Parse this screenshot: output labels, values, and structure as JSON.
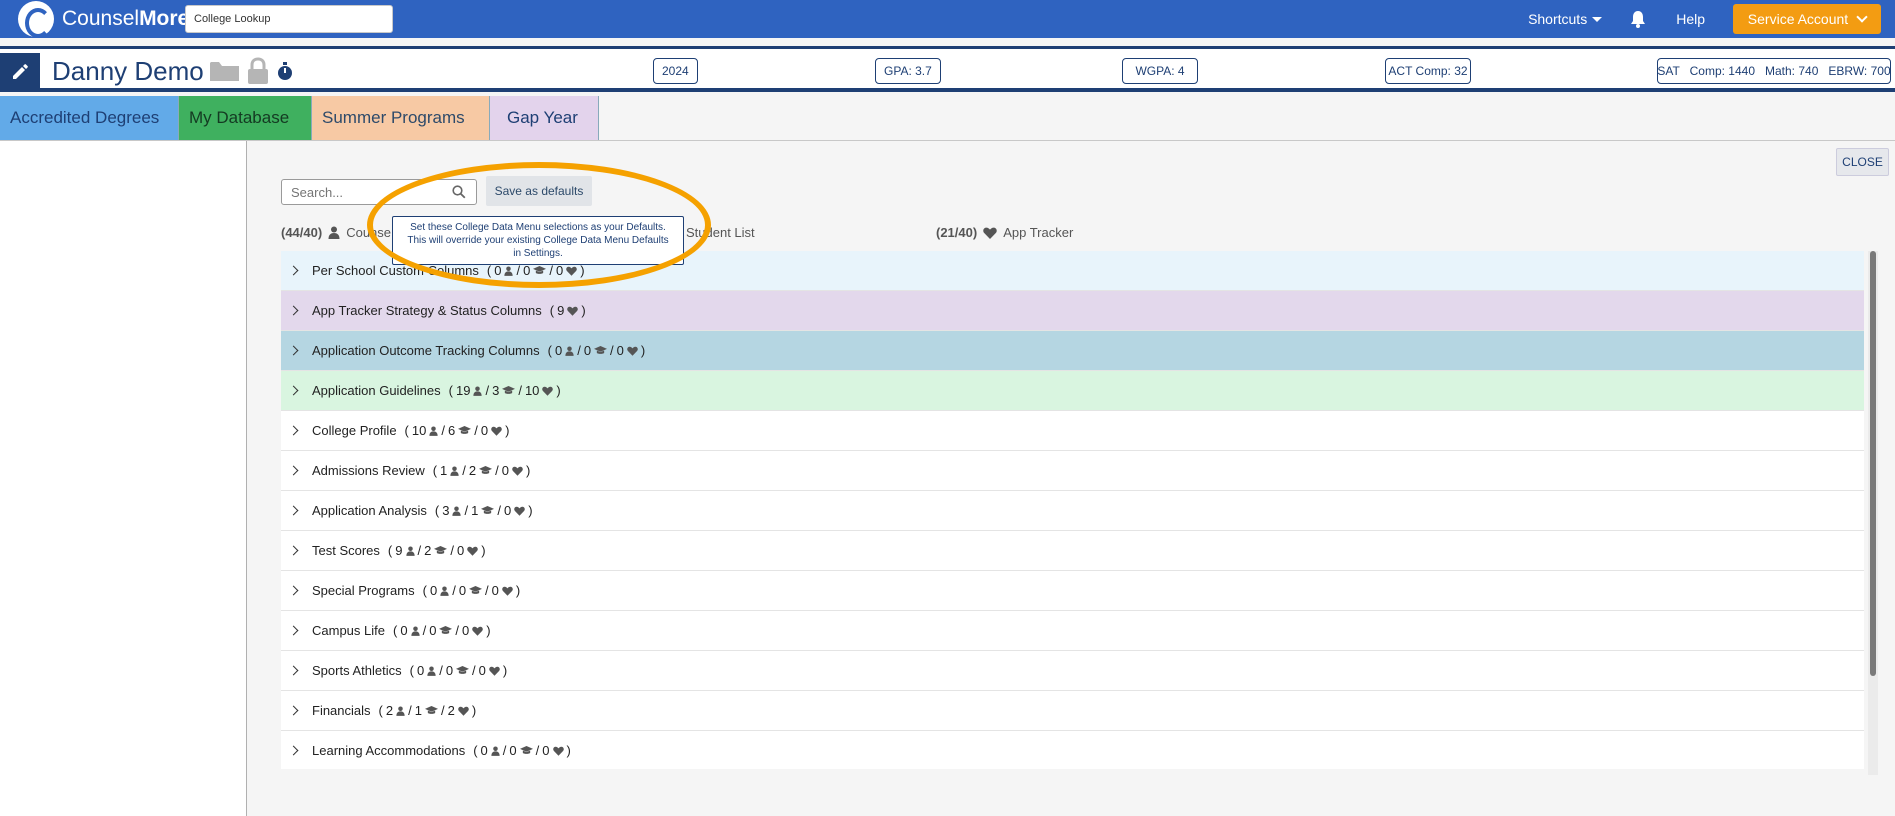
{
  "topbar": {
    "brand_light": "Counsel",
    "brand_bold": "More",
    "search_value": "College Lookup",
    "shortcuts_label": "Shortcuts",
    "help_label": "Help",
    "account_label": "Service Account"
  },
  "student": {
    "name": "Danny Demo",
    "chips": [
      "2024",
      "GPA: 3.7",
      "WGPA: 4",
      "ACT Comp: 32",
      "SAT   Comp: 1440   Math: 740   EBRW: 700"
    ]
  },
  "tabs": [
    "Accredited Degrees",
    "My Database",
    "Summer Programs",
    "Gap Year"
  ],
  "panel": {
    "close_label": "CLOSE",
    "search_placeholder": "Search...",
    "save_defaults_label": "Save as defaults",
    "tooltip_lines": [
      "Set these College Data Menu selections as your Defaults.",
      "This will override your existing College Data Menu Defaults",
      "in Settings."
    ],
    "counselor_count": "(44/40)",
    "counselor_label": "Counse",
    "student_list_label": "Student List",
    "tracker_count": "(21/40)",
    "tracker_label": "App Tracker"
  },
  "sections": [
    {
      "title": "Per School Custom Columns",
      "type": "full",
      "a": "0",
      "b": "0",
      "c": "0",
      "bg": "#e8f4fb"
    },
    {
      "title": "App Tracker Strategy & Status Columns",
      "type": "heart",
      "c": "9",
      "bg": "#e3d8ec"
    },
    {
      "title": "Application Outcome Tracking Columns",
      "type": "full",
      "a": "0",
      "b": "0",
      "c": "0",
      "bg": "#b5d6e2"
    },
    {
      "title": "Application Guidelines",
      "type": "full",
      "a": "19",
      "b": "3",
      "c": "10",
      "bg": "#d9f5e0"
    },
    {
      "title": "College Profile",
      "type": "full",
      "a": "10",
      "b": "6",
      "c": "0",
      "bg": "#ffffff"
    },
    {
      "title": "Admissions Review",
      "type": "full",
      "a": "1",
      "b": "2",
      "c": "0",
      "bg": "#ffffff"
    },
    {
      "title": "Application Analysis",
      "type": "full",
      "a": "3",
      "b": "1",
      "c": "0",
      "bg": "#ffffff"
    },
    {
      "title": "Test Scores",
      "type": "full",
      "a": "9",
      "b": "2",
      "c": "0",
      "bg": "#ffffff"
    },
    {
      "title": "Special Programs",
      "type": "full",
      "a": "0",
      "b": "0",
      "c": "0",
      "bg": "#ffffff"
    },
    {
      "title": "Campus Life",
      "type": "full",
      "a": "0",
      "b": "0",
      "c": "0",
      "bg": "#ffffff"
    },
    {
      "title": "Sports Athletics",
      "type": "full",
      "a": "0",
      "b": "0",
      "c": "0",
      "bg": "#ffffff"
    },
    {
      "title": "Financials",
      "type": "full",
      "a": "2",
      "b": "1",
      "c": "2",
      "bg": "#ffffff"
    },
    {
      "title": "Learning Accommodations",
      "type": "full",
      "a": "0",
      "b": "0",
      "c": "0",
      "bg": "#ffffff"
    }
  ],
  "colors": {
    "topbar": "#2f63c0",
    "navy": "#1e3f74",
    "account_button": "#f39c12",
    "highlight_ring": "#f5a100"
  }
}
